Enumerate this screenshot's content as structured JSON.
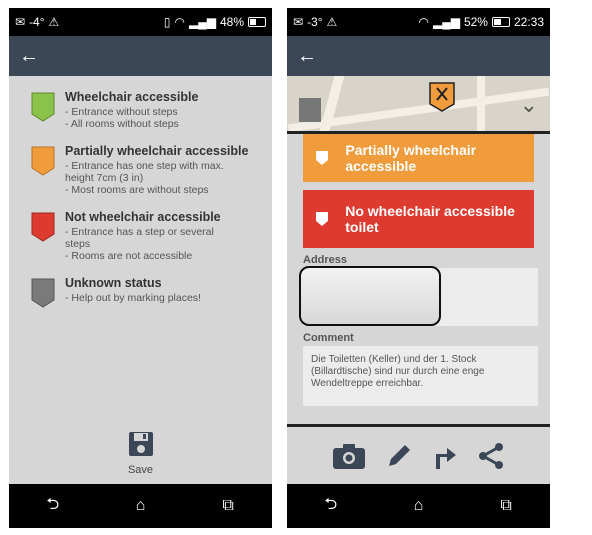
{
  "left_screen": {
    "status": {
      "signal_left": "-4°",
      "battery": "48%"
    },
    "toolbar": {
      "back": "←"
    },
    "legend": [
      {
        "title": "Wheelchair accessible",
        "color": "#8bc34a",
        "desc": "- Entrance without steps\n- All rooms without steps"
      },
      {
        "title": "Partially wheelchair accessible",
        "color": "#f19c3c",
        "desc": "- Entrance has one step with max. height 7cm (3 in)\n- Most rooms are without steps"
      },
      {
        "title": "Not wheelchair accessible",
        "color": "#de3b30",
        "desc": "- Entrance has a step or several steps\n- Rooms are not accessible"
      },
      {
        "title": "Unknown status",
        "color": "#7a7a7a",
        "desc": "- Help out by marking places!"
      }
    ],
    "save_label": "Save"
  },
  "right_screen": {
    "status": {
      "signal_left": "-3°",
      "battery": "52%",
      "time": "22:33"
    },
    "toolbar": {
      "back": "←"
    },
    "badges": [
      {
        "label": "Partially wheelchair accessible",
        "color": "#f19c3c"
      },
      {
        "label": "No wheelchair accessible toilet",
        "color": "#de3b30"
      }
    ],
    "address_label": "Address",
    "comment_label": "Comment",
    "comment_text": "Die Toiletten (Keller) und der 1. Stock (Billardtische) sind nur durch eine enge Wendeltreppe erreichbar.",
    "actions": [
      "camera-icon",
      "pencil-icon",
      "directions-icon",
      "share-icon"
    ]
  },
  "navbar": {
    "back": "⮌",
    "home": "⌂",
    "recents": "⧉"
  }
}
